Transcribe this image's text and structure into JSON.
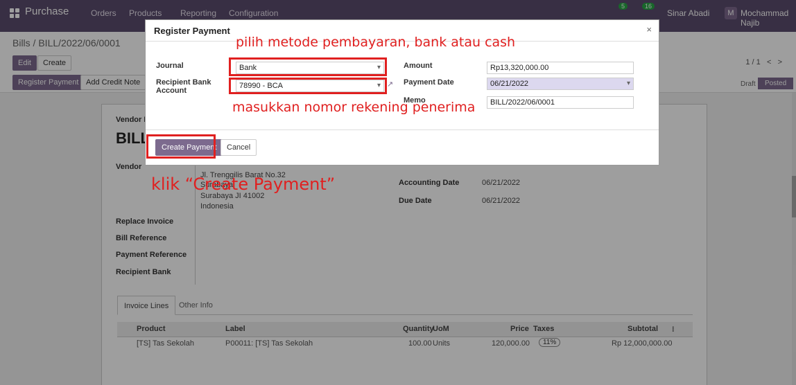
{
  "navbar": {
    "app_name": "Purchase",
    "menu": [
      "Orders",
      "Products",
      "Reporting",
      "Configuration"
    ],
    "badge_messages": "5",
    "badge_activities": "16",
    "company": "Sinar Abadi",
    "avatar_letter": "M",
    "user": "Mochammad Najib"
  },
  "control": {
    "breadcrumb": "Bills / BILL/2022/06/0001",
    "edit": "Edit",
    "create": "Create",
    "register_payment": "Register Payment",
    "add_credit_note": "Add Credit Note",
    "pager": "1 / 1",
    "pager_prev": "<",
    "pager_next": ">",
    "status_draft": "Draft",
    "status_posted": "Posted"
  },
  "form": {
    "vendor_bill_label": "Vendor B",
    "title": "BILL",
    "vendor_label": "Vendor",
    "address_line1": "Jl. Trenggilis Barat No.32",
    "address_line2": "Surabaya",
    "address_line3": "Surabaya JI 41002",
    "address_line4": "Indonesia",
    "accounting_date_label": "Accounting Date",
    "accounting_date": "06/21/2022",
    "due_date_label": "Due Date",
    "due_date": "06/21/2022",
    "replace_invoice": "Replace Invoice",
    "bill_reference": "Bill Reference",
    "payment_reference": "Payment Reference",
    "recipient_bank": "Recipient Bank",
    "tabs": [
      "Invoice Lines",
      "Other Info"
    ],
    "columns": {
      "product": "Product",
      "label": "Label",
      "quantity": "Quantity",
      "uom": "UoM",
      "price": "Price",
      "taxes": "Taxes",
      "subtotal": "Subtotal"
    },
    "rows": [
      {
        "product": "[TS] Tas Sekolah",
        "label": "P00011: [TS] Tas Sekolah",
        "quantity": "100.00",
        "uom": "Units",
        "price": "120,000.00",
        "taxes": "11%",
        "subtotal": "Rp 12,000,000.00"
      }
    ]
  },
  "modal": {
    "title": "Register Payment",
    "close": "×",
    "journal_label": "Journal",
    "journal_value": "Bank",
    "recipient_label_1": "Recipient Bank",
    "recipient_label_2": "Account",
    "recipient_value": "78990 - BCA",
    "amount_label": "Amount",
    "amount_value": "Rp13,320,000.00",
    "payment_date_label": "Payment Date",
    "payment_date_value": "06/21/2022",
    "memo_label": "Memo",
    "memo_value": "BILL/2022/06/0001",
    "create_payment": "Create Payment",
    "cancel": "Cancel"
  },
  "annotations": {
    "journal_hint": "pilih metode pembayaran, bank atau cash",
    "account_hint": "masukkan nomor rekening penerima",
    "button_hint": "klik “Create Payment”"
  },
  "colors": {
    "brand": "#7c6a8e",
    "annotation": "#e02020"
  }
}
